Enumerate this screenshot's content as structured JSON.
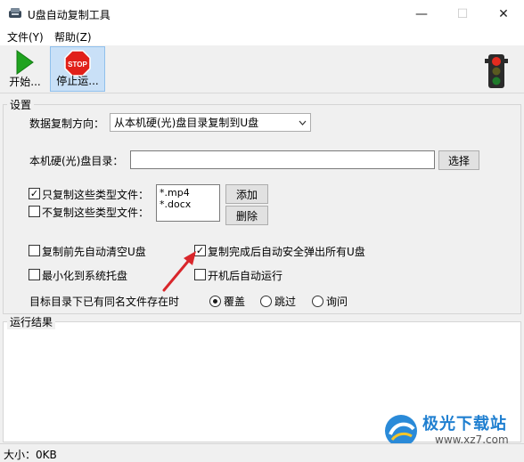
{
  "window": {
    "title": "U盘自动复制工具",
    "min_glyph": "—",
    "max_glyph": "☐",
    "close_glyph": "✕"
  },
  "menu": {
    "file": "文件(Y)",
    "help": "帮助(Z)"
  },
  "toolbar": {
    "start_label": "开始...",
    "stop_label": "停止运...",
    "stop_sign_text": "STOP"
  },
  "settings": {
    "group_title": "设置",
    "direction_label": "数据复制方向：",
    "direction_value": "从本机硬(光)盘目录复制到U盘",
    "local_dir_label": "本机硬(光)盘目录：",
    "local_dir_value": "",
    "browse_button": "选择",
    "only_copy_label": "只复制这些类型文件：",
    "only_copy_checked": true,
    "exclude_label": "不复制这些类型文件：",
    "exclude_checked": false,
    "file_types": [
      "*.mp4",
      "*.docx"
    ],
    "add_button": "添加",
    "delete_button": "删除",
    "clear_usb_label": "复制前先自动清空U盘",
    "clear_usb_checked": false,
    "eject_label": "复制完成后自动安全弹出所有U盘",
    "eject_checked": true,
    "minimize_tray_label": "最小化到系统托盘",
    "minimize_tray_checked": false,
    "autostart_label": "开机后自动运行",
    "autostart_checked": false,
    "conflict_label": "目标目录下已有同名文件存在时",
    "conflict_options": [
      "覆盖",
      "跳过",
      "询问"
    ],
    "conflict_selected": "覆盖"
  },
  "result": {
    "group_title": "运行结果"
  },
  "status": {
    "size_text": "大小：0KB"
  },
  "watermark": {
    "name": "极光下载站",
    "url": "www.xz7.com"
  },
  "colors": {
    "arrow_red": "#d9262b",
    "start_green": "#1fa31f",
    "stop_red": "#e1201a",
    "selected_tool_bg": "#c9e0f7"
  }
}
